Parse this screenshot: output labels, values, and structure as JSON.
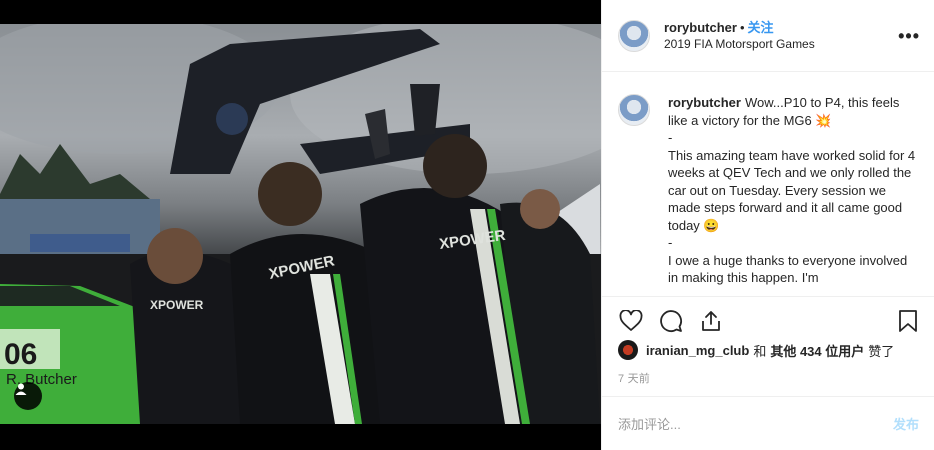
{
  "post": {
    "username": "rorybutcher",
    "follow_label": "关注",
    "location": "2019 FIA Motorsport Games",
    "more_label": "•••",
    "caption": {
      "username": "rorybutcher",
      "lines": [
        "Wow...P10 to P4, this feels like a victory for the MG6 💥",
        "-",
        "This amazing team have worked solid for 4 weeks at QEV Tech and we only rolled the car out on Tuesday. Every session we made steps forward and it all came good today 😀",
        "-",
        "I owe a huge thanks to everyone involved in making this happen. I'm"
      ]
    },
    "likes": {
      "liker": "iranian_mg_club",
      "connector": "和",
      "others": "其他 434 位用户",
      "suffix": "赞了"
    },
    "time": "7 天前",
    "add_comment_placeholder": "添加评论...",
    "post_button_label": "发布"
  },
  "photo": {
    "alt_subject": "XPOWER team celebrating",
    "car_number": "06",
    "car_driver": "R. Butcher",
    "jacket_brand": "XPOWER"
  },
  "icons": {
    "more": "more-horizontal-icon",
    "like": "heart-icon",
    "comment": "comment-bubble-icon",
    "share": "share-icon",
    "save": "bookmark-icon",
    "user_tag": "user-tag-icon"
  },
  "colors": {
    "link_blue": "#3897f0",
    "post_disabled": "#b2dffc",
    "muted": "#999999",
    "border": "#efefef"
  }
}
